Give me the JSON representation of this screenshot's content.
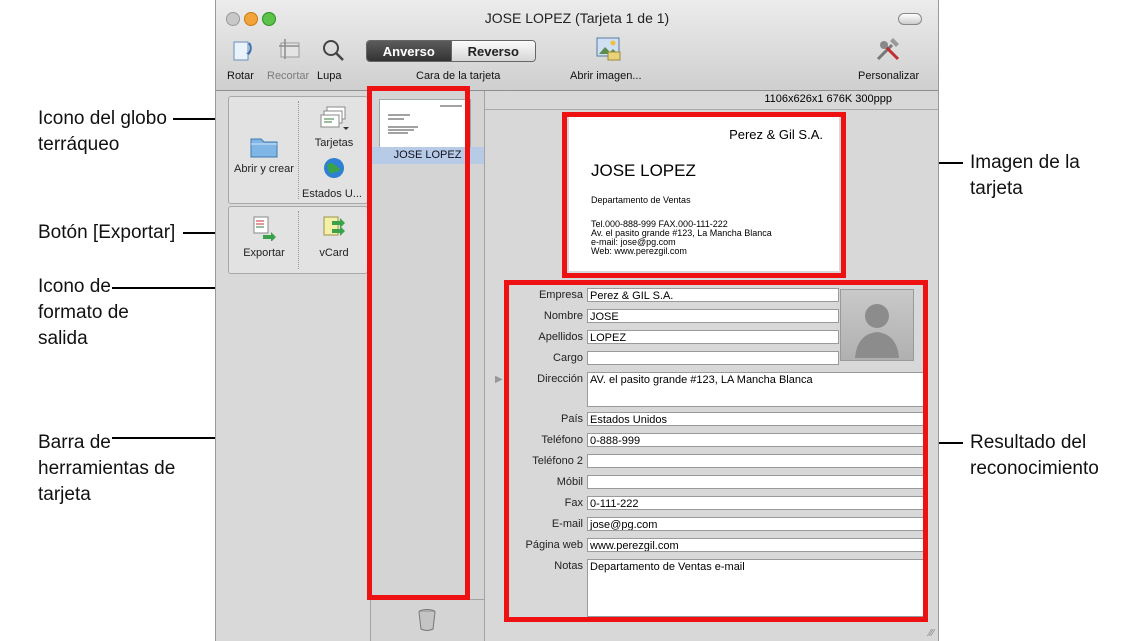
{
  "window": {
    "title": "JOSE LOPEZ (Tarjeta 1 de 1)"
  },
  "toolbar": {
    "rotate_label": "Rotar",
    "crop_label": "Recortar",
    "zoom_label": "Lupa",
    "front_label": "Anverso",
    "back_label": "Reverso",
    "card_side_label": "Cara de la tarjeta",
    "open_image_label": "Abrir imagen...",
    "customize_label": "Personalizar"
  },
  "left_toolbar": {
    "open_create_label": "Abrir y crear",
    "cards_label": "Tarjetas",
    "country_label": "Estados U...",
    "export_label": "Exportar",
    "vcard_label": "vCard"
  },
  "card_list": {
    "selected_name": "JOSE LOPEZ"
  },
  "image_info": "1106x626x1  676K  300ppp",
  "card_image": {
    "company": "Perez & Gil S.A.",
    "name": "JOSE LOPEZ",
    "department": "Departamento de Ventas",
    "line1": "Tel.000-888-999   FAX.000-111-222",
    "line2": "Av. el pasito grande #123, La Mancha Blanca",
    "line3": "e-mail: jose@pg.com",
    "line4": "Web: www.perezgil.com"
  },
  "fields": [
    {
      "label": "Empresa",
      "value": "Perez & GIL S.A."
    },
    {
      "label": "Nombre",
      "value": "JOSE"
    },
    {
      "label": "Apellidos",
      "value": "LOPEZ"
    },
    {
      "label": "Cargo",
      "value": ""
    },
    {
      "label": "Dirección",
      "value": "AV. el pasito grande #123, LA Mancha Blanca"
    },
    {
      "label": "País",
      "value": "Estados Unidos"
    },
    {
      "label": "Teléfono",
      "value": "0-888-999"
    },
    {
      "label": "Teléfono 2",
      "value": ""
    },
    {
      "label": "Móbil",
      "value": ""
    },
    {
      "label": "Fax",
      "value": "0-111-222"
    },
    {
      "label": "E-mail",
      "value": "jose@pg.com"
    },
    {
      "label": "Página web",
      "value": "www.perezgil.com"
    },
    {
      "label": "Notas",
      "value": "Departamento de Ventas e-mail"
    }
  ],
  "callouts": {
    "globe_icon": "Icono del globo terráqueo",
    "export_button": "Botón [Exportar]",
    "output_format_icon": "Icono de formato de salida",
    "card_toolbar": "Barra de herramientas de tarjeta",
    "card_image": "Imagen de la tarjeta",
    "recognition_result": "Resultado del reconocimiento"
  },
  "colors": {
    "highlight": "#ee1111",
    "selection": "#b7cbe6"
  }
}
